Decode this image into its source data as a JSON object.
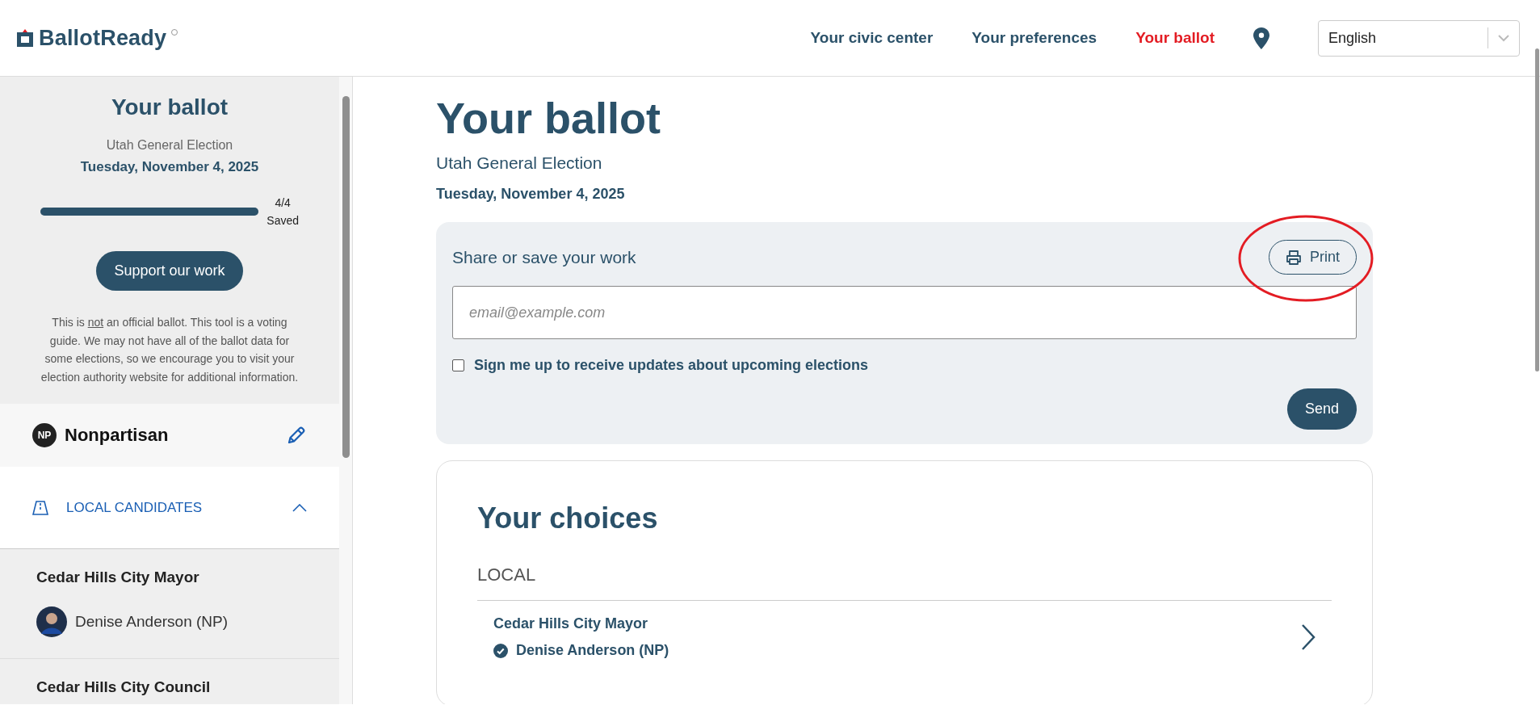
{
  "header": {
    "logo": "BallotReady",
    "nav": [
      {
        "label": "Your civic center",
        "selected": false
      },
      {
        "label": "Your preferences",
        "selected": false
      },
      {
        "label": "Your ballot",
        "selected": true
      }
    ],
    "language": "English"
  },
  "sidebar": {
    "title": "Your ballot",
    "election": "Utah General Election",
    "date": "Tuesday, November 4, 2025",
    "progress": {
      "level": 1.0,
      "count": "4/4",
      "label": "Saved"
    },
    "support_button": "Support our work",
    "disclaimer": {
      "before": "This is ",
      "underlined": "not",
      "after": " an official ballot. This tool is a voting guide. We may not have all of the ballot data for some elections, so we encourage you to visit your election authority website for additional information."
    },
    "party": {
      "badge": "NP",
      "name": "Nonpartisan"
    },
    "section": {
      "label": "LOCAL CANDIDATES",
      "expanded": true
    },
    "races": [
      {
        "title": "Cedar Hills City Mayor",
        "candidate": "Denise Anderson (NP)"
      },
      {
        "title": "Cedar Hills City Council"
      }
    ]
  },
  "main": {
    "title": "Your ballot",
    "election": "Utah General Election",
    "date": "Tuesday, November 4, 2025",
    "share": {
      "title": "Share or save your work",
      "print_button": "Print",
      "email_placeholder": "email@example.com",
      "signup": {
        "label": "Sign me up to receive updates about upcoming elections",
        "checked": false
      },
      "send_button": "Send"
    },
    "choices": {
      "title": "Your choices",
      "group": "LOCAL",
      "items": [
        {
          "race": "Cedar Hills City Mayor",
          "candidate": "Denise Anderson (NP)"
        }
      ]
    }
  }
}
